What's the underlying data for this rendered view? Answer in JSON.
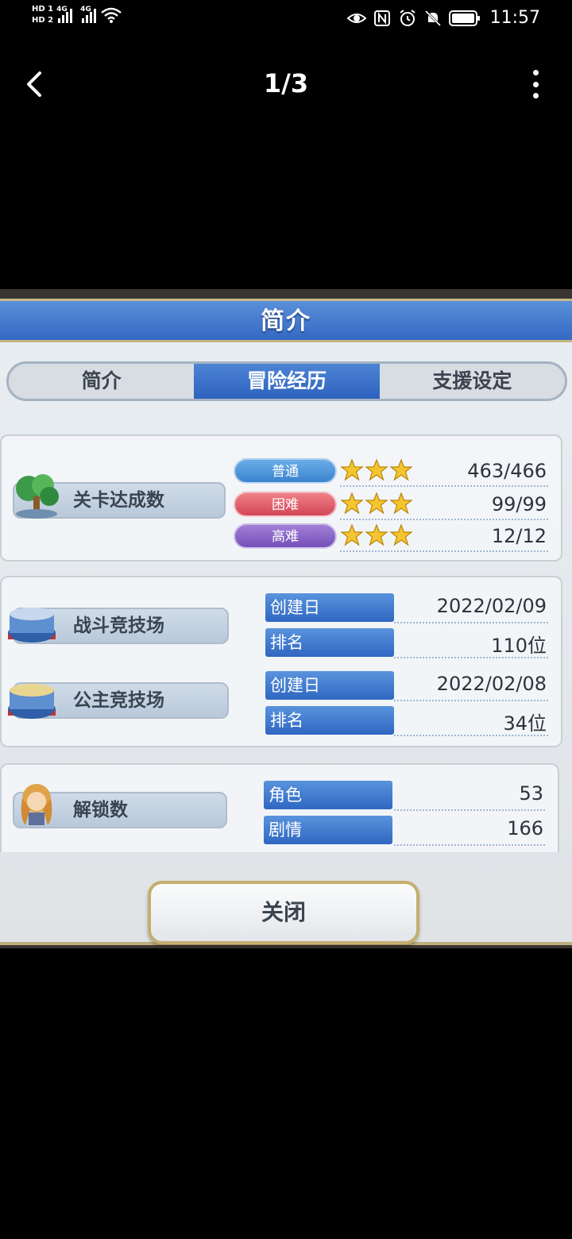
{
  "status_bar": {
    "sim1": "HD 1",
    "sim2": "HD 2",
    "network1": "4G",
    "network2": "4G",
    "time": "11:57",
    "icons": [
      "eye-icon",
      "nfc-icon",
      "alarm-icon",
      "mute-icon",
      "battery-icon"
    ]
  },
  "viewer": {
    "page_indicator": "1/3",
    "back_icon": "chevron-left-icon",
    "more_icon": "more-vertical-icon"
  },
  "game_panel": {
    "title": "简介",
    "tabs": [
      {
        "label": "简介",
        "active": false
      },
      {
        "label": "冒险经历",
        "active": true
      },
      {
        "label": "支援设定",
        "active": false
      }
    ],
    "stage_clear": {
      "label": "关卡达成数",
      "rows": [
        {
          "difficulty": "普通",
          "stars": 3,
          "value": "463/466",
          "color": "#3b82cf"
        },
        {
          "difficulty": "困难",
          "stars": 3,
          "value": "99/99",
          "color": "#d24657"
        },
        {
          "difficulty": "高难",
          "stars": 3,
          "value": "12/12",
          "color": "#7550b8"
        }
      ]
    },
    "battle_arena": {
      "label": "战斗竞技场",
      "rows": [
        {
          "key": "创建日",
          "value": "2022/02/09"
        },
        {
          "key": "排名",
          "value": "110位"
        }
      ]
    },
    "princess_arena": {
      "label": "公主竞技场",
      "rows": [
        {
          "key": "创建日",
          "value": "2022/02/08"
        },
        {
          "key": "排名",
          "value": "34位"
        }
      ]
    },
    "unlocks": {
      "label": "解锁数",
      "rows": [
        {
          "key": "角色",
          "value": "53"
        },
        {
          "key": "剧情",
          "value": "166"
        }
      ]
    },
    "close_label": "关闭"
  }
}
